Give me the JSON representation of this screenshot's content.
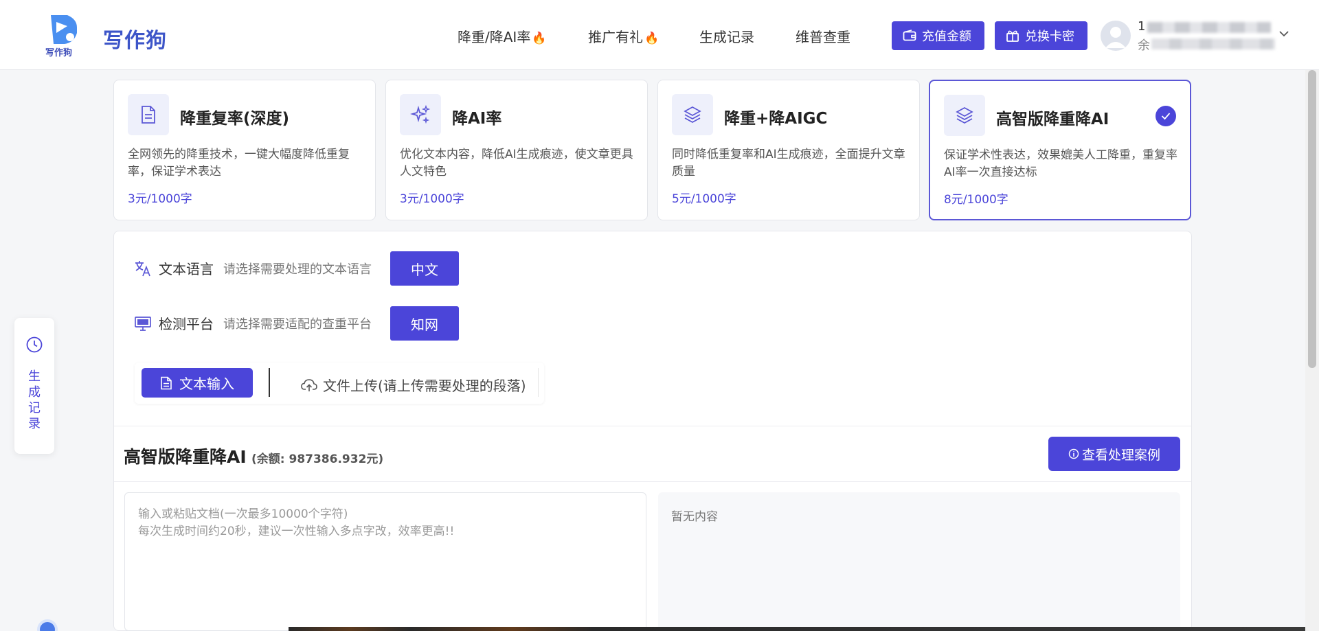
{
  "brand": {
    "name": "写作狗",
    "logo_sub": "写作狗"
  },
  "nav": {
    "items": [
      {
        "label": "降重/降AI率",
        "fire": "🔥"
      },
      {
        "label": "推广有礼",
        "fire": "🔥"
      },
      {
        "label": "生成记录"
      },
      {
        "label": "维普查重"
      }
    ],
    "recharge_label": "充值金额",
    "redeem_label": "兑换卡密"
  },
  "user": {
    "line1": "1",
    "line2": "余"
  },
  "services": [
    {
      "title": "降重复率(深度)",
      "desc": "全网领先的降重技术，一键大幅度降低重复率，保证学术表达",
      "price": "3元/1000字",
      "icon": "document-icon"
    },
    {
      "title": "降AI率",
      "desc": "优化文本内容，降低AI生成痕迹，使文章更具人文特色",
      "price": "3元/1000字",
      "icon": "sparkle-icon"
    },
    {
      "title": "降重+降AIGC",
      "desc": "同时降低重复率和AI生成痕迹，全面提升文章质量",
      "price": "5元/1000字",
      "icon": "layers-icon"
    },
    {
      "title": "高智版降重降AI",
      "desc": "保证学术性表达，效果媲美人工降重，重复率AI率一次直接达标",
      "price": "8元/1000字",
      "icon": "layers-icon",
      "selected": true
    }
  ],
  "options": {
    "language": {
      "label": "文本语言",
      "hint": "请选择需要处理的文本语言",
      "value": "中文"
    },
    "platform": {
      "label": "检测平台",
      "hint": "请选择需要适配的查重平台",
      "value": "知网"
    }
  },
  "input_tabs": {
    "text": "文本输入",
    "upload": "文件上传(请上传需要处理的段落)"
  },
  "section": {
    "title": "高智版降重降AI",
    "balance": "(余额: 987386.932元)",
    "case_button": "查看处理案例"
  },
  "editor": {
    "placeholder_line1": "输入或粘贴文档(一次最多10000个字符)",
    "placeholder_line2": "每次生成时间约20秒，建议一次性输入多点字改，效率更高!!",
    "empty_text": "暂无内容"
  },
  "float_history": {
    "label": "生成记录"
  },
  "colors": {
    "primary": "#4b45d9",
    "brand": "#3d55c8",
    "fire": "#f06a1d"
  }
}
